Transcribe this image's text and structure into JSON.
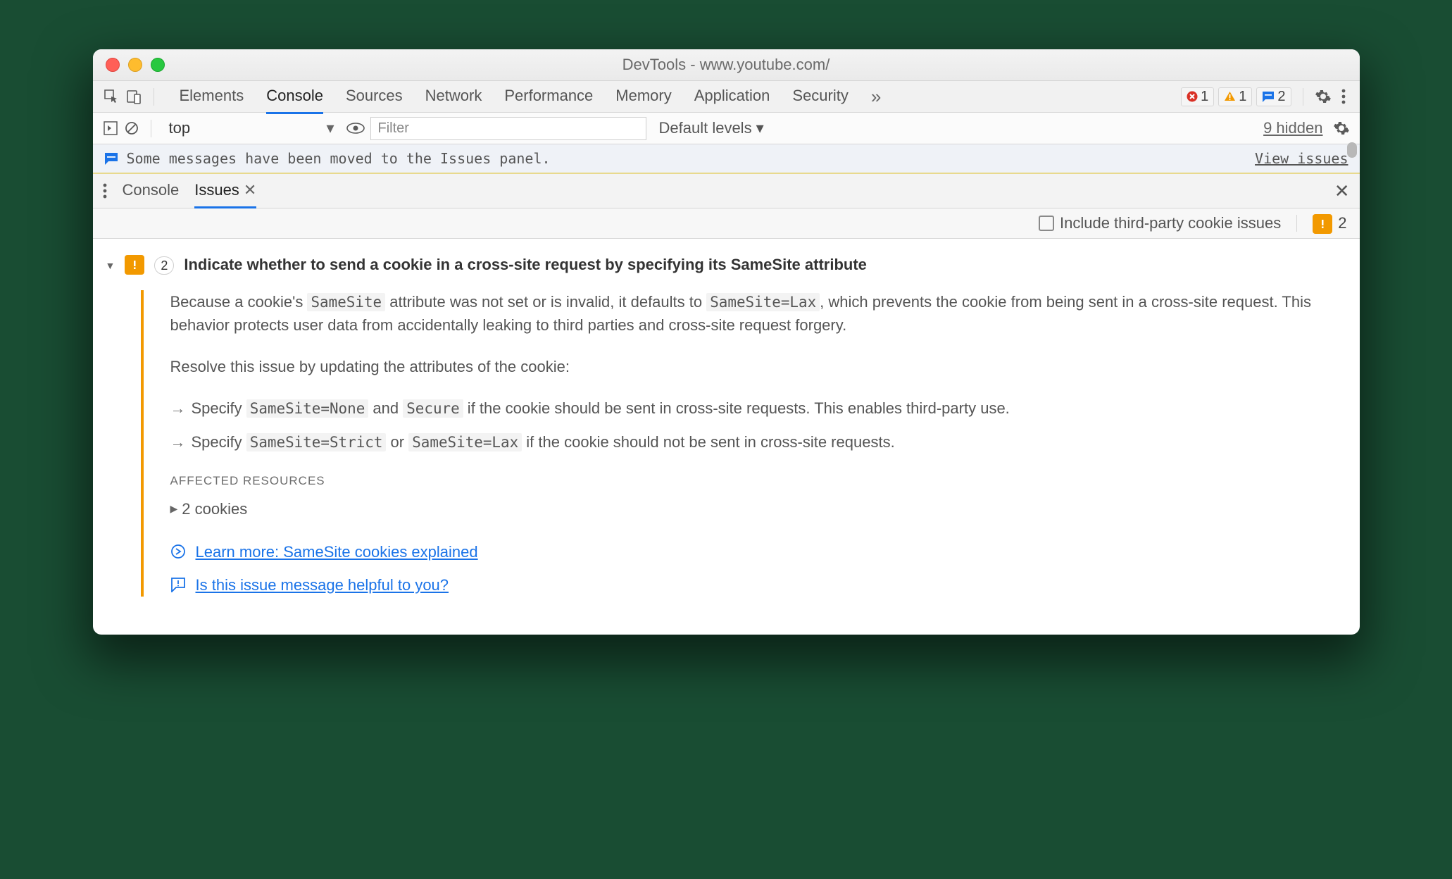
{
  "titlebar": {
    "title": "DevTools - www.youtube.com/"
  },
  "mainTabs": {
    "elements": "Elements",
    "console": "Console",
    "sources": "Sources",
    "network": "Network",
    "performance": "Performance",
    "memory": "Memory",
    "application": "Application",
    "security": "Security"
  },
  "statusChips": {
    "errors": "1",
    "warnings": "1",
    "info": "2"
  },
  "ctrlbar": {
    "context": "top",
    "filterPlaceholder": "Filter",
    "levels": "Default levels ▾",
    "hidden": "9 hidden"
  },
  "banner": {
    "text": "Some messages have been moved to the Issues panel.",
    "link": "View issues"
  },
  "drawerTabs": {
    "console": "Console",
    "issues": "Issues"
  },
  "subbar": {
    "thirdparty": "Include third-party cookie issues",
    "count": "2"
  },
  "issue": {
    "count": "2",
    "title": "Indicate whether to send a cookie in a cross-site request by specifying its SameSite attribute",
    "para1_a": "Because a cookie's ",
    "para1_b": "SameSite",
    "para1_c": " attribute was not set or is invalid, it defaults to ",
    "para1_d": "SameSite=Lax",
    "para1_e": ", which prevents the cookie from being sent in a cross-site request. This behavior protects user data from accidentally leaking to third parties and cross-site request forgery.",
    "para2": "Resolve this issue by updating the attributes of the cookie:",
    "bullet1_a": "Specify ",
    "bullet1_b": "SameSite=None",
    "bullet1_c": " and ",
    "bullet1_d": "Secure",
    "bullet1_e": " if the cookie should be sent in cross-site requests. This enables third-party use.",
    "bullet2_a": "Specify ",
    "bullet2_b": "SameSite=Strict",
    "bullet2_c": " or ",
    "bullet2_d": "SameSite=Lax",
    "bullet2_e": " if the cookie should not be sent in cross-site requests.",
    "affectedHeader": "AFFECTED RESOURCES",
    "affectedItem": "2 cookies",
    "learnMore": "Learn more: SameSite cookies explained",
    "feedback": "Is this issue message helpful to you?"
  }
}
